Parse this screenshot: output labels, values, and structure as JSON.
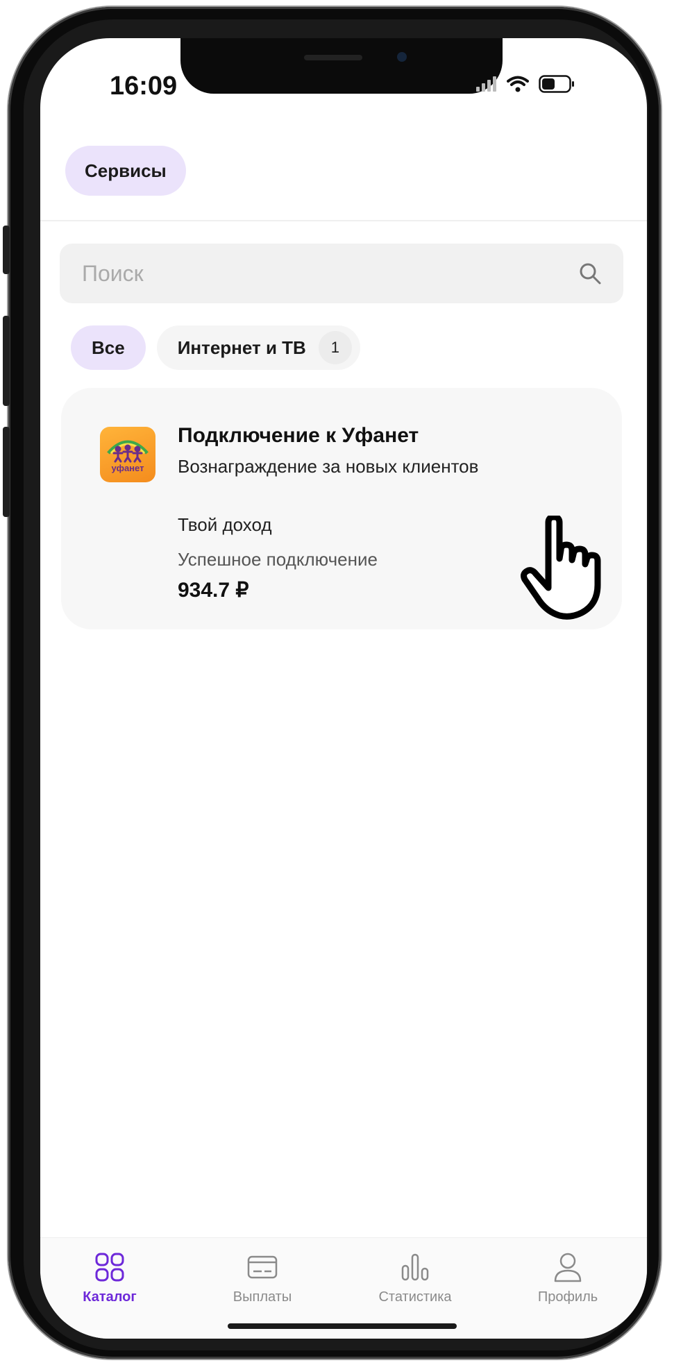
{
  "status_bar": {
    "time": "16:09"
  },
  "header": {
    "services_label": "Сервисы"
  },
  "search": {
    "placeholder": "Поиск"
  },
  "filters": {
    "all_label": "Все",
    "category_label": "Интернет и ТВ",
    "category_count": "1"
  },
  "card": {
    "title": "Подключение к Уфанет",
    "subtitle": "Вознаграждение за новых клиентов",
    "income_label": "Твой доход",
    "event_label": "Успешное подключение",
    "amount": "934.7 ₽",
    "logo_text": "уфанет"
  },
  "tabbar": {
    "items": [
      {
        "label": "Каталог",
        "icon": "grid-icon"
      },
      {
        "label": "Выплаты",
        "icon": "card-icon"
      },
      {
        "label": "Статистика",
        "icon": "bar-chart-icon"
      },
      {
        "label": "Профиль",
        "icon": "user-icon"
      }
    ]
  },
  "colors": {
    "accent": "#6d28d9",
    "pill_bg": "#ebe3fb",
    "card_bg": "#f7f7f7"
  }
}
